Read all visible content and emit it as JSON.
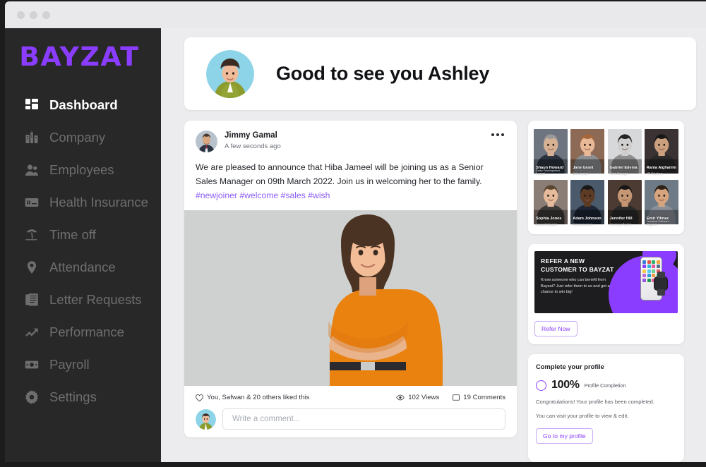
{
  "window": {
    "dots": [
      "close-dot",
      "minimize-dot",
      "maximize-dot"
    ]
  },
  "colors": {
    "brand_purple": "#8B3DFF",
    "hashtag_purple": "#8B5CF6",
    "sidebar_bg": "#282828",
    "app_bg": "#ECECEE",
    "card_bg": "#FFFFFF",
    "nav_inactive": "#6E6E6E",
    "nav_active": "#FFFFFF"
  },
  "sidebar": {
    "logo": "BAYZAT",
    "items": [
      {
        "label": "Dashboard",
        "icon": "dashboard-icon",
        "active": true
      },
      {
        "label": "Company",
        "icon": "building-icon",
        "active": false
      },
      {
        "label": "Employees",
        "icon": "people-icon",
        "active": false
      },
      {
        "label": "Health Insurance",
        "icon": "insurance-card-icon",
        "active": false
      },
      {
        "label": "Time off",
        "icon": "beach-umbrella-icon",
        "active": false
      },
      {
        "label": "Attendance",
        "icon": "location-pin-icon",
        "active": false
      },
      {
        "label": "Letter Requests",
        "icon": "documents-icon",
        "active": false
      },
      {
        "label": "Performance",
        "icon": "trend-up-icon",
        "active": false
      },
      {
        "label": "Payroll",
        "icon": "cash-icon",
        "active": false
      },
      {
        "label": "Settings",
        "icon": "gear-icon",
        "active": false
      }
    ]
  },
  "greeting": {
    "title": "Good to see you Ashley",
    "avatar": "user-avatar-ashley"
  },
  "post": {
    "author": "Jimmy Gamal",
    "timestamp": "A few seconds ago",
    "avatar": "author-avatar-jimmy",
    "more_icon": "more-options-icon",
    "body_text": "We are pleased to announce that Hiba Jameel will be joining us as a Senior Sales Manager on 09th March 2022. Join us in welcoming her to the family. ",
    "hashtags": [
      "#newjoiner",
      "#welcome",
      "#sales",
      "#wish"
    ],
    "image": "new-joiner-photo",
    "likes_text": "You, Safwan & 20 others liked this",
    "like_icon": "heart-icon",
    "views_text": "102 Views",
    "views_icon": "eye-icon",
    "comments_text": "19 Comments",
    "comments_icon": "comment-icon",
    "comment_placeholder": "Write a comment...",
    "comment_value": "",
    "comment_avatar": "user-avatar-ashley"
  },
  "people": [
    {
      "name": "Shaun Howard",
      "role": "Sales Development Analyst",
      "tone": "#6f7580"
    },
    {
      "name": "Jane Grant",
      "role": "Data Analyst",
      "tone": "#8d6a55"
    },
    {
      "name": "Gabriel Edema",
      "role": "Sales Manager",
      "tone": "#d6d8d9"
    },
    {
      "name": "Rania Aighanim",
      "role": "HR Relations",
      "tone": "#3b3233"
    },
    {
      "name": "Sophia Jones",
      "role": "Account Manager",
      "tone": "#8a7d76"
    },
    {
      "name": "Adam Johnson",
      "role": "Motor Insurance",
      "tone": "#4a5a6b"
    },
    {
      "name": "Jennifer Hill",
      "role": "Insurance Partner",
      "tone": "#4b3b33"
    },
    {
      "name": "Emir Yilmaz",
      "role": "Frontend Software Engineer",
      "tone": "#6e7b86"
    }
  ],
  "refer": {
    "title": "REFER A NEW CUSTOMER TO BAYZAT",
    "subtitle": "Know someone who can benefit from Bayzat? Just refer them to us and get a chance to win big!",
    "button_label": "Refer Now",
    "banner_image": "phone-and-watch-illustration"
  },
  "profile": {
    "heading": "Complete your profile",
    "percent": "100%",
    "percent_label": "Profile Completion",
    "line_1": "Congratulations! Your profile has been completed.",
    "line_2": "You can visit your profile to view & edit.",
    "button_label": "Go to my profile",
    "ring_icon": "progress-ring-icon"
  }
}
